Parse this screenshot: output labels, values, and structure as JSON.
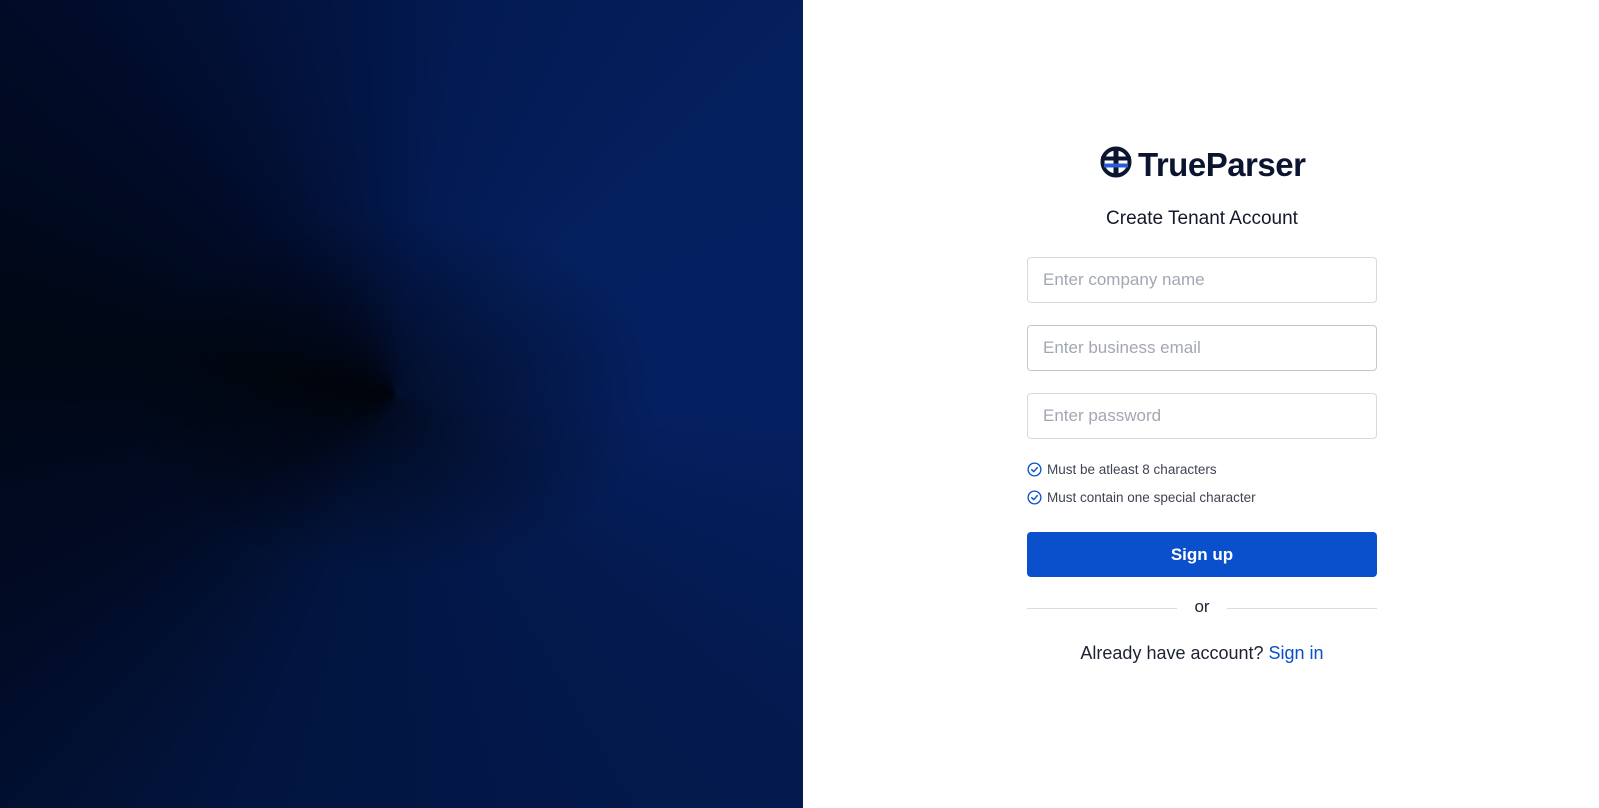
{
  "brand": {
    "name": "TrueParser",
    "icon": "trueparser-logo-icon",
    "accent_color": "#0a4fcb",
    "dark_color": "#0b1530"
  },
  "form": {
    "title": "Create Tenant Account",
    "company_placeholder": "Enter company name",
    "company_value": "",
    "email_placeholder": "Enter business email",
    "email_value": "",
    "password_placeholder": "Enter password",
    "password_value": "",
    "rules": [
      {
        "text": "Must be atleast 8 characters",
        "icon": "check-circle-icon"
      },
      {
        "text": "Must contain one special character",
        "icon": "check-circle-icon"
      }
    ],
    "submit_label": "Sign up",
    "divider_text": "or",
    "signin_prompt": "Already have account?",
    "signin_link": "Sign in"
  }
}
